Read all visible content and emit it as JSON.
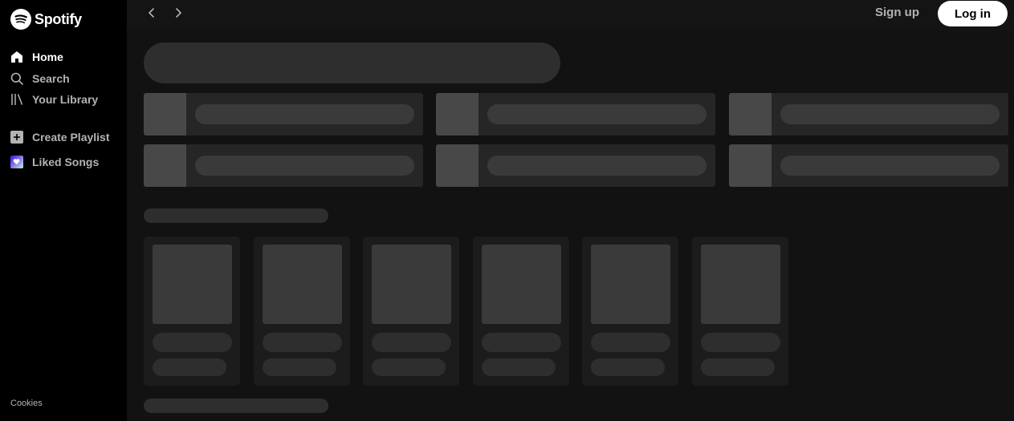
{
  "brand": {
    "name": "Spotify",
    "color": "#ffffff"
  },
  "sidebar": {
    "items": [
      {
        "label": "Home",
        "icon": "home-icon",
        "active": true
      },
      {
        "label": "Search",
        "icon": "search-icon",
        "active": false
      },
      {
        "label": "Your Library",
        "icon": "library-icon",
        "active": false
      }
    ],
    "actions": [
      {
        "label": "Create Playlist",
        "icon": "plus-icon"
      },
      {
        "label": "Liked Songs",
        "icon": "heart-icon"
      }
    ],
    "footer_link": "Cookies"
  },
  "header": {
    "signup_label": "Sign up",
    "login_label": "Log in"
  },
  "colors": {
    "background": "#000000",
    "main": "#121212",
    "skeleton": "#2e2e2e",
    "liked_songs_gradient": [
      "#450af5",
      "#c4efd9"
    ]
  }
}
